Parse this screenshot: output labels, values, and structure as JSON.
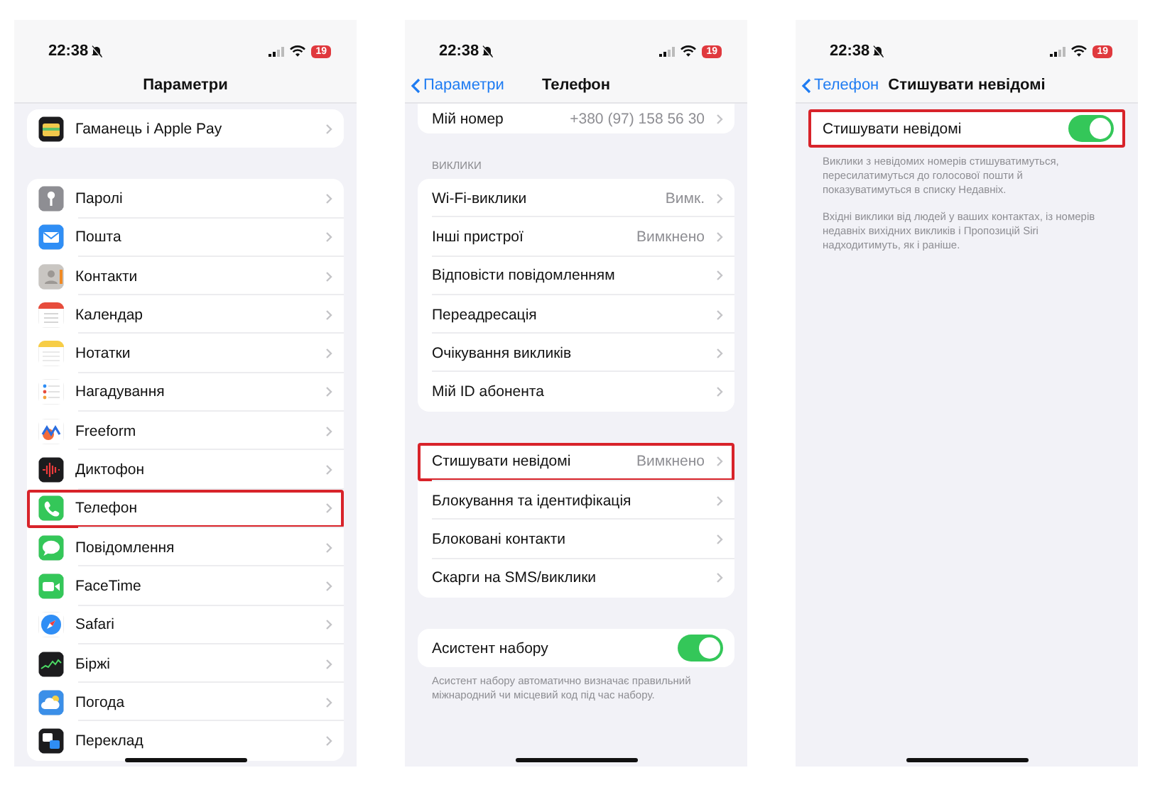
{
  "screens": [
    {
      "status": {
        "time": "22:38",
        "battery": "19"
      },
      "nav": {
        "title": "Параметри"
      },
      "groups": [
        {
          "items": [
            {
              "kind": "app",
              "label": "Гаманець і Apple Pay",
              "highlighted": false
            }
          ]
        },
        {
          "items": [
            {
              "kind": "app",
              "label": "Паролі",
              "highlighted": false
            },
            {
              "kind": "app",
              "label": "Пошта",
              "highlighted": false
            },
            {
              "kind": "app",
              "label": "Контакти",
              "highlighted": false
            },
            {
              "kind": "app",
              "label": "Календар",
              "highlighted": false
            },
            {
              "kind": "app",
              "label": "Нотатки",
              "highlighted": false
            },
            {
              "kind": "app",
              "label": "Нагадування",
              "highlighted": false
            },
            {
              "kind": "app",
              "label": "Freeform",
              "highlighted": false
            },
            {
              "kind": "app",
              "label": "Диктофон",
              "highlighted": false
            },
            {
              "kind": "app",
              "label": "Телефон",
              "highlighted": true
            },
            {
              "kind": "app",
              "label": "Повідомлення",
              "highlighted": false
            },
            {
              "kind": "app",
              "label": "FaceTime",
              "highlighted": false
            },
            {
              "kind": "app",
              "label": "Safari",
              "highlighted": false
            },
            {
              "kind": "app",
              "label": "Біржі",
              "highlighted": false
            },
            {
              "kind": "app",
              "label": "Погода",
              "highlighted": false
            },
            {
              "kind": "app",
              "label": "Переклад",
              "highlighted": false
            }
          ]
        }
      ]
    },
    {
      "status": {
        "time": "22:38",
        "battery": "19"
      },
      "nav": {
        "back": "Параметри",
        "title": "Телефон"
      },
      "groups": [
        {
          "clipped_top": true,
          "items": [
            {
              "kind": "link",
              "label": "Мій номер",
              "value": "+380 (97) 158 56 30",
              "highlighted": false
            }
          ]
        },
        {
          "header": "ВИКЛИКИ",
          "items": [
            {
              "kind": "link",
              "label": "Wi-Fi-виклики",
              "value": "Вимк.",
              "highlighted": false
            },
            {
              "kind": "link",
              "label": "Інші пристрої",
              "value": "Вимкнено",
              "highlighted": false
            },
            {
              "kind": "link",
              "label": "Відповісти повідомленням",
              "highlighted": false
            },
            {
              "kind": "link",
              "label": "Переадресація",
              "highlighted": false
            },
            {
              "kind": "link",
              "label": "Очікування викликів",
              "highlighted": false
            },
            {
              "kind": "link",
              "label": "Мій ID абонента",
              "highlighted": false
            }
          ]
        },
        {
          "items": [
            {
              "kind": "link",
              "label": "Стишувати невідомі",
              "value": "Вимкнено",
              "highlighted": true
            },
            {
              "kind": "link",
              "label": "Блокування та ідентифікація",
              "highlighted": false
            },
            {
              "kind": "link",
              "label": "Блоковані контакти",
              "highlighted": false
            },
            {
              "kind": "link",
              "label": "Скарги на SMS/виклики",
              "highlighted": false
            }
          ]
        },
        {
          "items": [
            {
              "kind": "toggle",
              "label": "Асистент набору",
              "on": true,
              "highlighted": false
            }
          ],
          "footer": [
            "Асистент набору автоматично визначає правильний міжнародний чи місцевий код під час набору."
          ]
        }
      ]
    },
    {
      "status": {
        "time": "22:38",
        "battery": "19"
      },
      "nav": {
        "back": "Телефон",
        "title": "Стишувати невідомі"
      },
      "groups": [
        {
          "items": [
            {
              "kind": "toggle",
              "label": "Стишувати невідомі",
              "on": true,
              "highlighted": true
            }
          ],
          "footer": [
            "Виклики з невідомих номерів стишуватимуться, пересилатимуться до голосової пошти й показуватимуться в списку Недавніх.",
            "Вхідні виклики від людей у ваших контактах, із номерів недавніх вихідних викликів і Пропозицій Siri надходитимуть, як і раніше."
          ]
        }
      ]
    }
  ]
}
